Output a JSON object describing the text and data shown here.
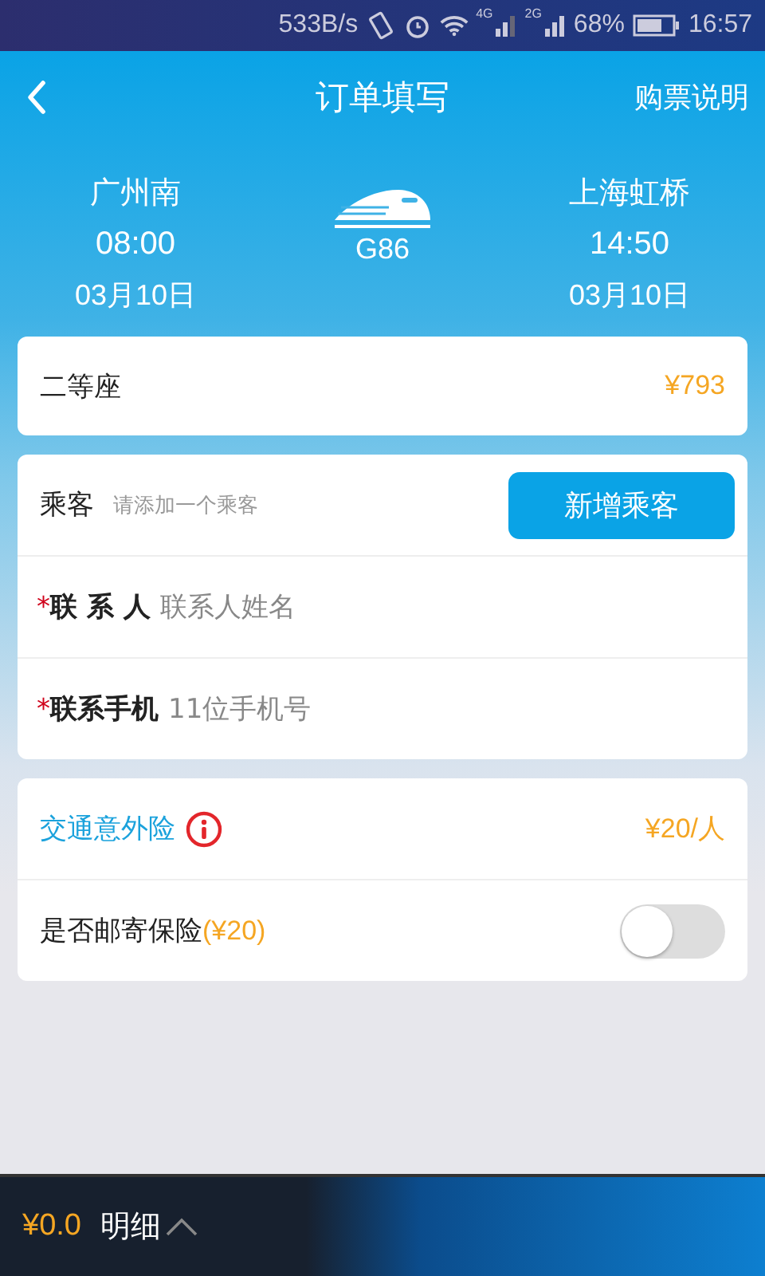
{
  "status_bar": {
    "speed": "533B/s",
    "net_1": "4G",
    "net_2": "2G",
    "battery": "68%",
    "time": "16:57"
  },
  "nav": {
    "title": "订单填写",
    "action": "购票说明"
  },
  "trip": {
    "from": {
      "station": "广州南",
      "time": "08:00",
      "date": "03月10日"
    },
    "train": "G86",
    "to": {
      "station": "上海虹桥",
      "time": "14:50",
      "date": "03月10日"
    }
  },
  "seat": {
    "name": "二等座",
    "price": "¥793"
  },
  "passenger": {
    "label": "乘客",
    "hint": "请添加一个乘客",
    "button": "新增乘客"
  },
  "contacts": [
    {
      "mark": "*",
      "label": "联 系 人",
      "placeholder": "联系人姓名"
    },
    {
      "mark": "*",
      "label": "联系手机",
      "placeholder": "11位手机号"
    }
  ],
  "insurance": {
    "accident": {
      "label": "交通意外险",
      "price": "¥20/人"
    },
    "mail": {
      "label": "是否邮寄保险",
      "price": "(¥20)",
      "on": false
    }
  },
  "footer": {
    "total": "¥0.0",
    "detail": "明细"
  }
}
